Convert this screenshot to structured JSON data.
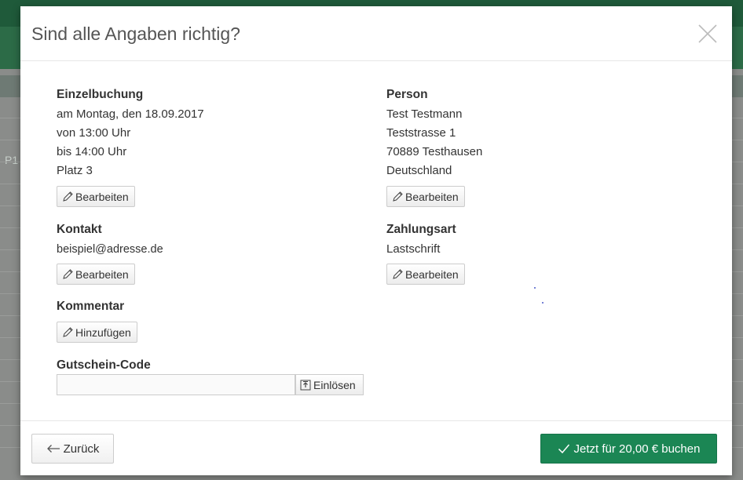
{
  "modal": {
    "title": "Sind alle Angaben richtig?",
    "close_icon": "close-icon"
  },
  "booking": {
    "title": "Einzelbuchung",
    "date": "am Montag, den 18.09.2017",
    "from": "von 13:00 Uhr",
    "to": "bis 14:00 Uhr",
    "court": "Platz 3",
    "edit_label": "Bearbeiten"
  },
  "person": {
    "title": "Person",
    "name": "Test Testmann",
    "street": "Teststrasse 1",
    "city": "70889 Testhausen",
    "country": "Deutschland",
    "edit_label": "Bearbeiten"
  },
  "contact": {
    "title": "Kontakt",
    "email": "beispiel@adresse.de",
    "edit_label": "Bearbeiten"
  },
  "payment": {
    "title": "Zahlungsart",
    "method": "Lastschrift",
    "edit_label": "Bearbeiten"
  },
  "comment": {
    "title": "Kommentar",
    "add_label": "Hinzufügen"
  },
  "voucher": {
    "title": "Gutschein-Code",
    "value": "",
    "placeholder": "",
    "redeem_label": "Einlösen"
  },
  "footer": {
    "back_label": "Zurück",
    "book_label": "Jetzt für 20,00 € buchen"
  },
  "background": {
    "header_fragment": "P1"
  },
  "colors": {
    "primary_green": "#1b8654",
    "topbar_green": "#1f5a3a"
  },
  "icons": {
    "edit": "pencil-icon",
    "back": "arrow-left-icon",
    "confirm": "checkmark-icon",
    "redeem": "upload-icon"
  }
}
